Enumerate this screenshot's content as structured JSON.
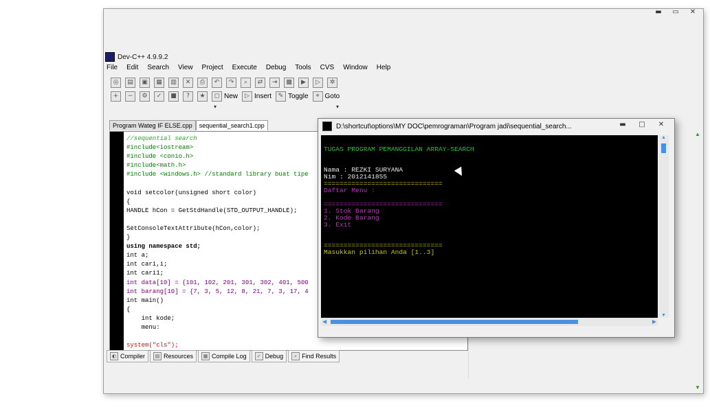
{
  "app": {
    "title": "Dev-C++ 4.9.9.2"
  },
  "window_controls": {
    "minimize": "▬",
    "restore": "▭",
    "close": "✕"
  },
  "menu": [
    "File",
    "Edit",
    "Search",
    "View",
    "Project",
    "Execute",
    "Debug",
    "Tools",
    "CVS",
    "Window",
    "Help"
  ],
  "toolbar": {
    "new_label": "New",
    "insert_label": "Insert",
    "toggle_label": "Toggle",
    "goto_label": "Goto"
  },
  "file_tabs": [
    "Program Wateg IF ELSE.cpp",
    "sequential_search1.cpp"
  ],
  "editor": {
    "lines": [
      "//sequential search",
      "#include<iostream>",
      "#include <conio.h>",
      "#include<math.h>",
      "#include <windows.h> //standard library buat tipe",
      "",
      "void setcolor(unsigned short color)",
      "{",
      "HANDLE hCon = GetStdHandle(STD_OUTPUT_HANDLE);",
      "",
      "SetConsoleTextAttribute(hCon,color);",
      "}",
      "using namespace std;",
      "int a;",
      "int cari,i;",
      "int cari1;",
      "int data[10] = {101, 102, 201, 301, 302, 401, 500",
      "int barang[10] = {7, 3, 5, 12, 8, 21, 7, 3, 17, 4",
      "int main()",
      "{",
      "    int kode;",
      "    menu:",
      "",
      "system(\"cls\");"
    ]
  },
  "bottom_tabs": [
    "Compiler",
    "Resources",
    "Compile Log",
    "Debug",
    "Find Results"
  ],
  "console": {
    "title": "D:\\shortcut\\options\\MY DOC\\pemrograman\\Program jadi\\sequential_search...",
    "controls": {
      "minimize": "▬",
      "restore": "□",
      "close": "✕"
    },
    "heading": "TUGAS PROGRAM PEMANGGILAN ARRAY-SEARCH",
    "name_line": "Nama : REZKI SURYANA",
    "nim_line": "Nim : 2012141855",
    "separator": "==============================",
    "menu_title": "Daftar Menu :",
    "options": [
      "1. Stok Barang",
      "2. Kode Barang",
      "3. Exit"
    ],
    "prompt": "Masukkan pilihan Anda [1..3]"
  }
}
